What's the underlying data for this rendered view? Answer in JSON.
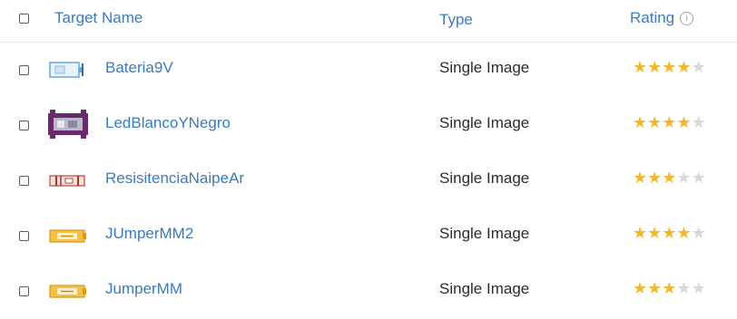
{
  "header": {
    "target_name": "Target Name",
    "type": "Type",
    "rating": "Rating",
    "info_glyph": "i"
  },
  "colors": {
    "link": "#3a7bbf",
    "star_on": "#f1b82d",
    "star_off": "#d8d8d8"
  },
  "rows": [
    {
      "name": "Bateria9V",
      "type": "Single Image",
      "rating": 4,
      "thumb": "battery-thumbnail-icon"
    },
    {
      "name": "LedBlancoYNegro",
      "type": "Single Image",
      "rating": 4,
      "thumb": "led-thumbnail-icon"
    },
    {
      "name": "ResisitenciaNaipeAr",
      "type": "Single Image",
      "rating": 3,
      "thumb": "resistor-thumbnail-icon"
    },
    {
      "name": "JUmperMM2",
      "type": "Single Image",
      "rating": 4,
      "thumb": "jumper-thumbnail-icon"
    },
    {
      "name": "JumperMM",
      "type": "Single Image",
      "rating": 3,
      "thumb": "jumper-thumbnail-icon"
    }
  ]
}
